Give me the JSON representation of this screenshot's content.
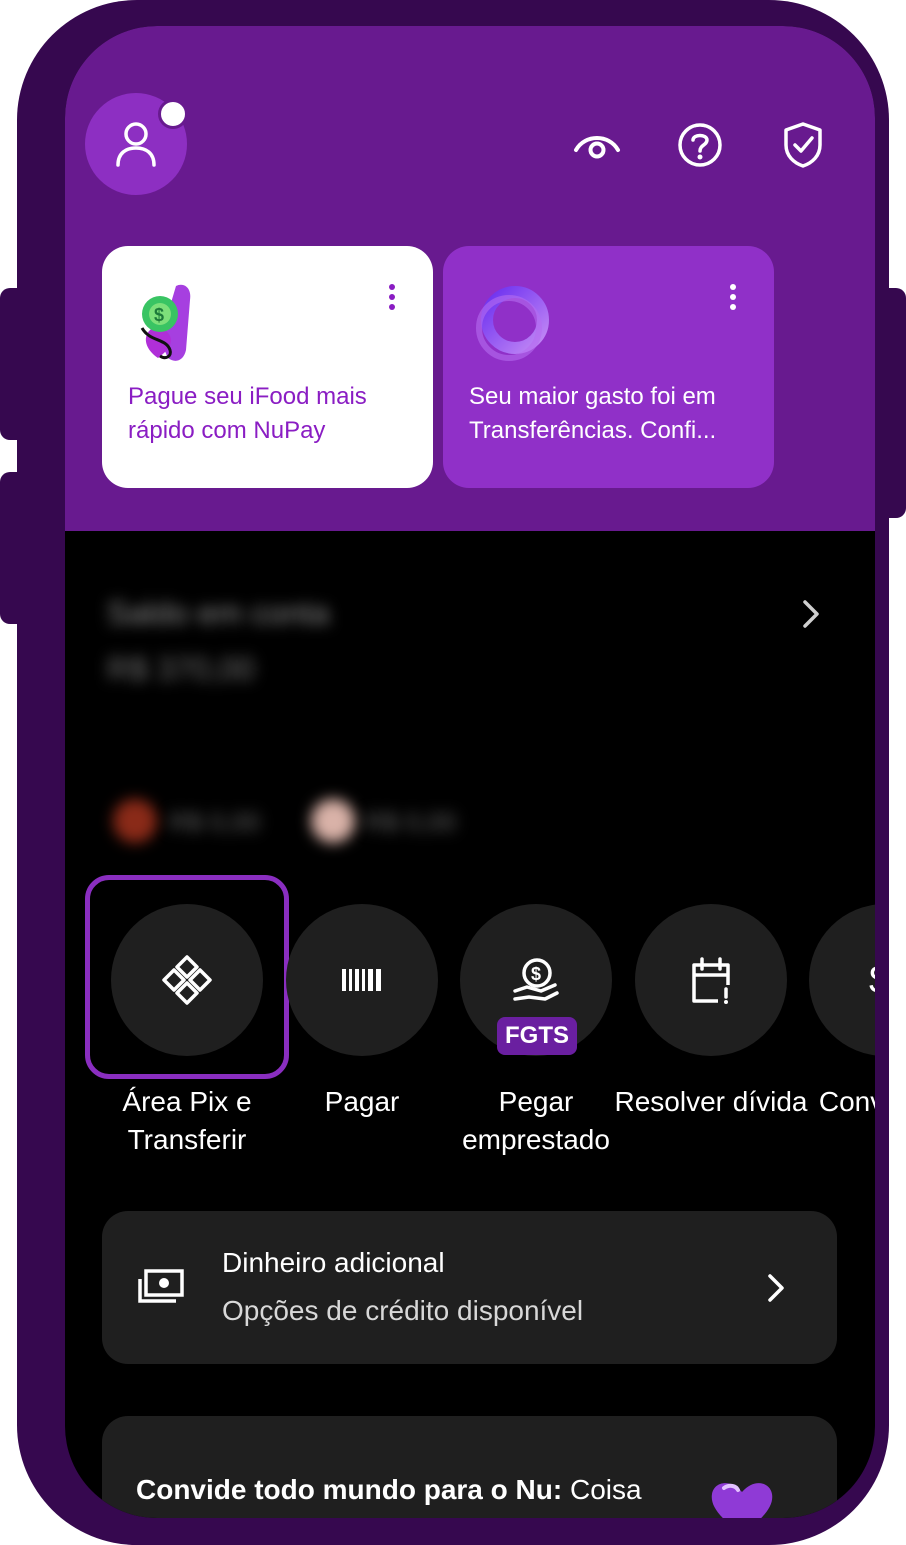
{
  "header": {
    "visibility_icon": "eye-icon",
    "help_icon": "help-icon",
    "security_icon": "shield-check-icon"
  },
  "cards": [
    {
      "text": "Pague seu iFood mais rápido com NuPay",
      "icon": "nupay-ifood-icon"
    },
    {
      "text": "Seu maior gasto foi em Transferências. Confi...",
      "icon": "ring-icon"
    }
  ],
  "balance": {
    "label": "Saldo em conta",
    "value": "R$ 370,00",
    "chip1": "R$ 0,00",
    "chip2": "R$ 0,00"
  },
  "shortcuts": [
    {
      "label": "Área Pix e Transferir",
      "icon": "pix-icon"
    },
    {
      "label": "Pagar",
      "icon": "barcode-icon"
    },
    {
      "label": "Pegar emprestado",
      "icon": "loan-icon",
      "badge": "FGTS"
    },
    {
      "label": "Resolver dívida",
      "icon": "calendar-alert-icon"
    },
    {
      "label": "Convidar li",
      "icon": "invite-icon"
    }
  ],
  "credit_row": {
    "title": "Dinheiro adicional",
    "subtitle": "Opções de crédito disponível"
  },
  "invite_row": {
    "title_bold": "Convide todo mundo para o Nu:",
    "title_rest": " Coisa"
  },
  "colors": {
    "header_bg": "#681a8f",
    "frame": "#36084f",
    "accent": "#8a2ec0",
    "tile": "#1f1f1f"
  }
}
